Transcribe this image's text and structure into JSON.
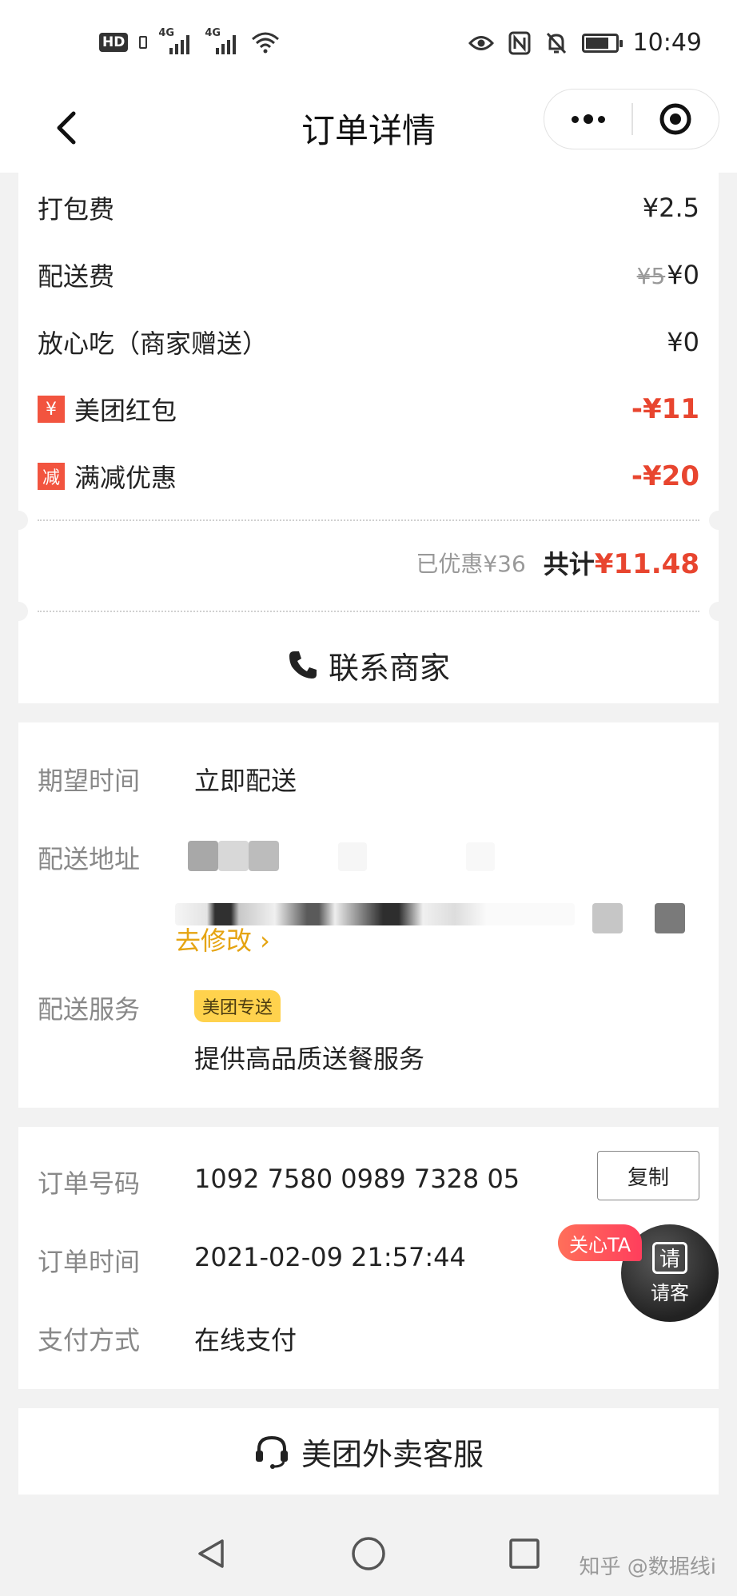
{
  "status_bar": {
    "hd_label": "HD",
    "net1": "4G",
    "net2": "4G",
    "time": "10:49"
  },
  "nav": {
    "title": "订单详情"
  },
  "fees": {
    "packing": {
      "label": "打包费",
      "value": "¥2.5"
    },
    "delivery": {
      "label": "配送费",
      "original": "¥5",
      "value": "¥0"
    },
    "assurance": {
      "label": "放心吃（商家赠送）",
      "value": "¥0"
    },
    "red_packet": {
      "icon_text": "¥",
      "label": "美团红包",
      "value": "-¥11"
    },
    "discount": {
      "icon_text": "减",
      "label": "满减优惠",
      "value": "-¥20"
    },
    "saved": "已优惠¥36",
    "total_label": "共计",
    "total_value": "¥11.48",
    "contact_label": "联系商家"
  },
  "delivery": {
    "expected_time": {
      "label": "期望时间",
      "value": "立即配送"
    },
    "address": {
      "label": "配送地址"
    },
    "edit_link": "去修改 ›",
    "service": {
      "label": "配送服务",
      "badge": "美团专送",
      "desc": "提供高品质送餐服务"
    }
  },
  "order": {
    "number": {
      "label": "订单号码",
      "value": "1092 7580 0989 7328 05"
    },
    "copy_label": "复制",
    "time": {
      "label": "订单时间",
      "value": "2021-02-09 21:57:44"
    },
    "payment": {
      "label": "支付方式",
      "value": "在线支付"
    }
  },
  "treat": {
    "tag": "关心TA",
    "glyph": "请",
    "label": "请客"
  },
  "service": {
    "label": "美团外卖客服"
  },
  "watermark": "知乎 @数据线i"
}
